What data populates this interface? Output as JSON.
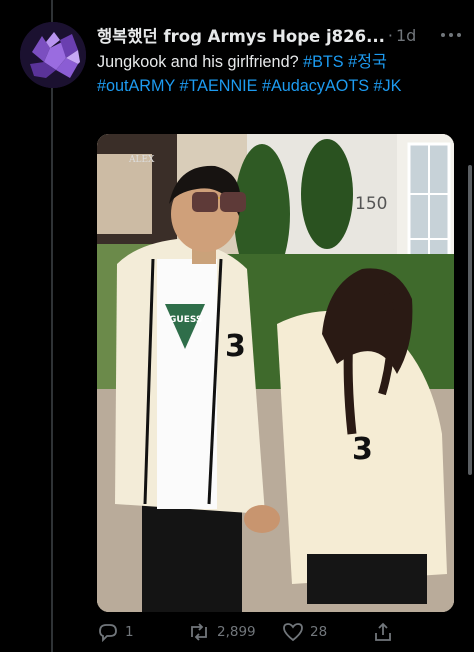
{
  "tweet": {
    "display_name": "행복했던 frog Armys Hope j826...",
    "separator": "·",
    "time": "1d",
    "text_plain": "Jungkook and his girlfriend? ",
    "hashtags": [
      "#BTS",
      "#정국",
      "#outARMY",
      "#TAENNIE",
      "#AudacyAOTS",
      "#JK"
    ]
  },
  "media": {
    "sign_text": "ALEX",
    "building_number": "150",
    "shirt_brand": "GUESS",
    "cardigan_number_left": "3",
    "cardigan_number_right": "3"
  },
  "actions": {
    "reply_count": "1",
    "retweet_count": "2,899",
    "like_count": "28"
  },
  "icons": {
    "reply": "reply-icon",
    "retweet": "retweet-icon",
    "like": "heart-icon",
    "share": "share-icon",
    "more": "more-icon"
  }
}
